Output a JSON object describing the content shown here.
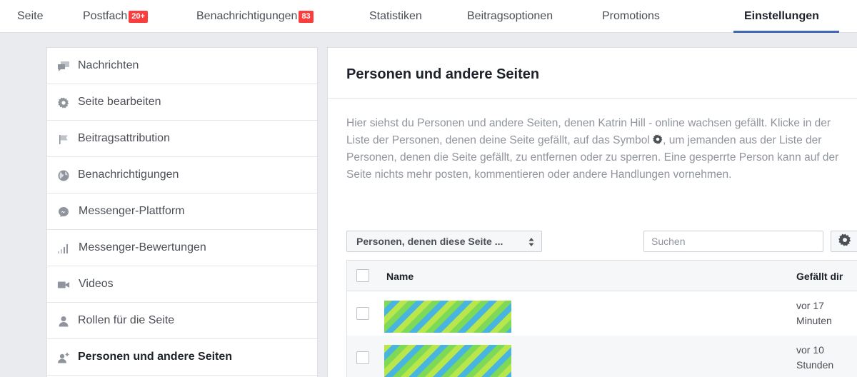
{
  "topnav": {
    "tabs": [
      {
        "label": "Seite"
      },
      {
        "label": "Postfach",
        "badge": "20+"
      },
      {
        "label": "Benachrichtigungen",
        "badge": "83"
      },
      {
        "label": "Statistiken"
      },
      {
        "label": "Beitragsoptionen"
      },
      {
        "label": "Promotions"
      },
      {
        "label": "Einstellungen",
        "active": true
      }
    ]
  },
  "sidebar": {
    "items": [
      {
        "label": "Nachrichten",
        "icon": "chat-bubbles-icon"
      },
      {
        "label": "Seite bearbeiten",
        "icon": "gear-icon"
      },
      {
        "label": "Beitragsattribution",
        "icon": "flag-icon"
      },
      {
        "label": "Benachrichtigungen",
        "icon": "globe-icon"
      },
      {
        "label": "Messenger-Plattform",
        "icon": "messenger-icon"
      },
      {
        "label": "Messenger-Bewertungen",
        "icon": "signal-bars-icon"
      },
      {
        "label": "Videos",
        "icon": "video-camera-icon"
      },
      {
        "label": "Rollen für die Seite",
        "icon": "person-icon"
      },
      {
        "label": "Personen und andere Seiten",
        "icon": "person-add-icon",
        "active": true
      }
    ]
  },
  "main": {
    "title": "Personen und andere Seiten",
    "desc_part1": "Hier siehst du Personen und andere Seiten, denen Katrin Hill - online wachsen gefällt. Klicke in der Liste der Personen, denen deine Seite gefällt, auf das Symbol ",
    "desc_part2": ", um jemanden aus der Liste der Personen, denen die Seite gefällt, zu entfernen oder zu sperren. Eine gesperrte Person kann auf der Seite nichts mehr posten, kommentieren oder andere Handlungen vornehmen.",
    "filter_label": "Personen, denen diese Seite ...",
    "search_placeholder": "Suchen",
    "table": {
      "col_name": "Name",
      "col_liked": "Gefällt dir",
      "rows": [
        {
          "time_line1": "vor 17",
          "time_line2": "Minuten"
        },
        {
          "time_line1": "vor 10",
          "time_line2": "Stunden"
        }
      ]
    }
  },
  "colors": {
    "accent": "#4267b2",
    "badge": "#fa3e3e",
    "background": "#e9ebee"
  }
}
